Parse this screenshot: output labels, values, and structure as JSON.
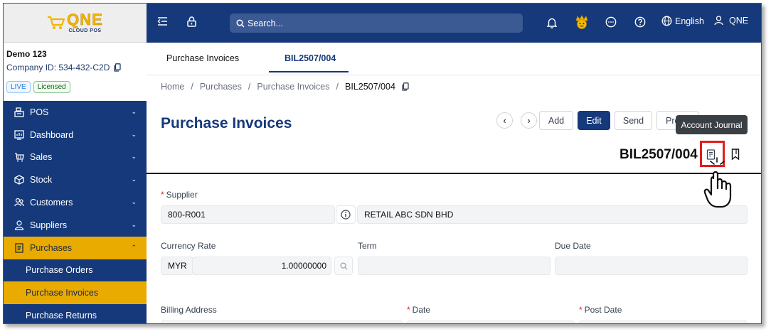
{
  "logo": {
    "brand": "QNE",
    "sub": "CLOUD POS"
  },
  "company": {
    "name": "Demo 123",
    "id": "Company ID: 534-432-C2D",
    "badges": [
      "LIVE",
      "Licensed"
    ]
  },
  "sidebar": {
    "items": [
      {
        "label": "POS",
        "icon": "pos-icon"
      },
      {
        "label": "Dashboard",
        "icon": "dashboard-icon"
      },
      {
        "label": "Sales",
        "icon": "sales-icon"
      },
      {
        "label": "Stock",
        "icon": "stock-icon"
      },
      {
        "label": "Customers",
        "icon": "customers-icon"
      },
      {
        "label": "Suppliers",
        "icon": "suppliers-icon"
      },
      {
        "label": "Purchases",
        "icon": "purchases-icon",
        "active": true
      }
    ],
    "sub_items": [
      {
        "label": "Purchase Orders"
      },
      {
        "label": "Purchase Invoices",
        "active": true
      },
      {
        "label": "Purchase Returns"
      }
    ]
  },
  "topbar": {
    "search_placeholder": "Search...",
    "language": "English",
    "user": "QNE"
  },
  "tabs": [
    {
      "label": "Purchase Invoices"
    },
    {
      "label": "BIL2507/004",
      "active": true
    }
  ],
  "breadcrumb": {
    "items": [
      "Home",
      "Purchases",
      "Purchase Invoices"
    ],
    "current": "BIL2507/004"
  },
  "page": {
    "title": "Purchase Invoices",
    "doc_no": "BIL2507/004"
  },
  "toolbar": {
    "add": "Add",
    "edit": "Edit",
    "send": "Send",
    "preview_partial": "Pre"
  },
  "tooltip": "Account Journal",
  "form": {
    "supplier_label": "Supplier",
    "supplier_code": "800-R001",
    "supplier_name": "RETAIL ABC SDN BHD",
    "currency_rate_label": "Currency Rate",
    "currency": "MYR",
    "rate": "1.00000000",
    "term_label": "Term",
    "due_date_label": "Due Date",
    "billing_address_label": "Billing Address",
    "date_label": "Date",
    "post_date_label": "Post Date"
  },
  "colors": {
    "primary": "#15397a",
    "accent": "#e9ab00",
    "highlight": "#e11d1d"
  }
}
